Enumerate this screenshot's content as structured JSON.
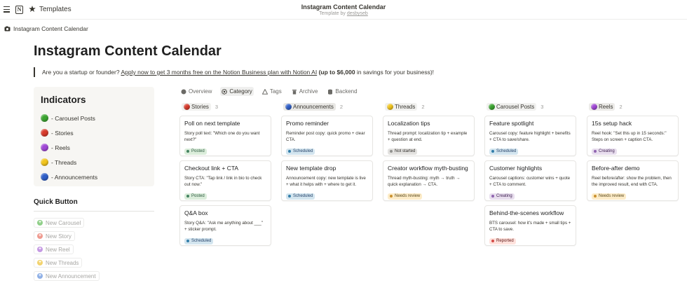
{
  "topbar": {
    "crumb": "Templates",
    "title": "Instagram Content Calendar",
    "subtitle_prefix": "Template by",
    "author": "desbyseb"
  },
  "page": {
    "crumb": "Instagram Content Calendar",
    "title": "Instagram Content Calendar"
  },
  "callout": {
    "prefix": "Are you a startup or founder?",
    "link": "Apply now to get 3 months free on the Notion Business plan with Notion AI",
    "bold": "(up to $6,000",
    "suffix": "in savings for your business)!"
  },
  "indicators": {
    "title": "Indicators",
    "items": [
      {
        "label": "- Carousel Posts",
        "color": "#3aa42f"
      },
      {
        "label": "- Stories",
        "color": "#d83a2b"
      },
      {
        "label": "- Reels",
        "color": "#a047d6"
      },
      {
        "label": "- Threads",
        "color": "#f2c51c"
      },
      {
        "label": "- Announcements",
        "color": "#2f5fc8"
      }
    ]
  },
  "quick": {
    "title": "Quick Button",
    "buttons": [
      {
        "label": "New Carousel",
        "color": "#8fcf88"
      },
      {
        "label": "New Story",
        "color": "#ef9a8f"
      },
      {
        "label": "New Reel",
        "color": "#c59ae3"
      },
      {
        "label": "New Threads",
        "color": "#f2d36e"
      },
      {
        "label": "New Announcement",
        "color": "#8fb0e6"
      }
    ]
  },
  "tabs": [
    {
      "label": "Overview",
      "icon": "circle-icon"
    },
    {
      "label": "Category",
      "icon": "gear-icon",
      "active": true
    },
    {
      "label": "Tags",
      "icon": "triangle-icon"
    },
    {
      "label": "Archive",
      "icon": "trash-icon"
    },
    {
      "label": "Backend",
      "icon": "database-icon"
    }
  ],
  "columns": [
    {
      "name": "Stories",
      "count": "3",
      "color": "#d83a2b",
      "tag_bg": "#f1f1ef",
      "cards": [
        {
          "title": "Poll on next template",
          "body": "Story poll text: \"Which one do you want next?\"",
          "status": "Posted"
        },
        {
          "title": "Checkout link + CTA",
          "body": "Story CTA: \"Tap link / link in bio to check out now.\"",
          "status": "Posted"
        },
        {
          "title": "Q&A box",
          "body": "Story Q&A: \"Ask me anything about ___\" + sticker prompt.",
          "status": "Scheduled"
        }
      ]
    },
    {
      "name": "Announcements",
      "count": "2",
      "color": "#2f5fc8",
      "tag_bg": "#e9e8e5",
      "cards": [
        {
          "title": "Promo reminder",
          "body": "Reminder post copy: quick promo + clear CTA.",
          "status": "Scheduled"
        },
        {
          "title": "New template drop",
          "body": "Announcement copy: new template is live + what it helps with + where to get it.",
          "status": "Scheduled"
        }
      ]
    },
    {
      "name": "Threads",
      "count": "2",
      "color": "#f2c51c",
      "tag_bg": "#f1f1ef",
      "cards": [
        {
          "title": "Localization tips",
          "body": "Thread prompt: localization tip + example + question at end.",
          "status": "Not started"
        },
        {
          "title": "Creator workflow myth-busting",
          "body": "Thread myth-busting: myth → truth → quick explanation → CTA.",
          "status": "Needs review"
        }
      ]
    },
    {
      "name": "Carousel Posts",
      "count": "3",
      "color": "#3aa42f",
      "tag_bg": "#f1f1ef",
      "cards": [
        {
          "title": "Feature spotlight",
          "body": "Carousel copy: feature highlight + benefits + CTA to save/share.",
          "status": "Scheduled"
        },
        {
          "title": "Customer highlights",
          "body": "Carousel captions: customer wins + quote + CTA to comment.",
          "status": "Creating"
        },
        {
          "title": "Behind-the-scenes workflow",
          "body": "BTS carousel: how it's made + small tips + CTA to save.",
          "status": "Reported"
        }
      ]
    },
    {
      "name": "Reels",
      "count": "2",
      "color": "#a047d6",
      "tag_bg": "#ecebe8",
      "cards": [
        {
          "title": "15s setup hack",
          "body": "Reel hook: \"Set this up in 15 seconds:\" Steps on screen + caption CTA.",
          "status": "Creating"
        },
        {
          "title": "Before-after demo",
          "body": "Reel before/after: show the problem, then the improved result, end with CTA.",
          "status": "Needs review"
        }
      ]
    }
  ],
  "status_styles": {
    "Posted": {
      "bg": "#dbeddb",
      "dot": "#448361",
      "fg": "#2b593f"
    },
    "Scheduled": {
      "bg": "#d3e5ef",
      "dot": "#337ea9",
      "fg": "#28456c"
    },
    "Not started": {
      "bg": "#e3e2e0",
      "dot": "#91918e",
      "fg": "#32302c"
    },
    "Needs review": {
      "bg": "#fdecc8",
      "dot": "#cb912f",
      "fg": "#5a4a1f"
    },
    "Creating": {
      "bg": "#e8deee",
      "dot": "#9065b0",
      "fg": "#412454"
    },
    "Reported": {
      "bg": "#ffe2dd",
      "dot": "#d44c47",
      "fg": "#5d1715"
    }
  }
}
